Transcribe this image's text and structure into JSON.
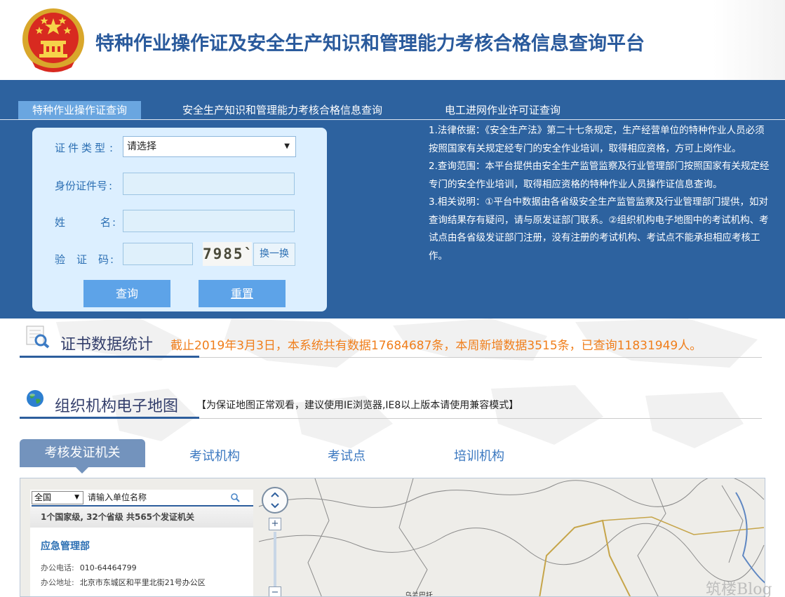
{
  "header": {
    "title": "特种作业操作证及安全生产知识和管理能力考核合格信息查询平台"
  },
  "tabs": [
    {
      "label": "特种作业操作证查询",
      "active": true
    },
    {
      "label": "安全生产知识和管理能力考核合格信息查询",
      "active": false
    },
    {
      "label": "电工进网作业许可证查询",
      "active": false
    }
  ],
  "query_form": {
    "cert_type_label": "证件类型",
    "cert_type_value": "请选择",
    "id_label": "身份证件号",
    "name_label_1": "姓",
    "name_label_2": "名",
    "code_label_1": "验",
    "code_label_2": "证",
    "code_label_3": "码",
    "colon": ":",
    "captcha_text": "7985`",
    "refresh_label": "换一换",
    "query_label": "查询",
    "reset_label": "重置"
  },
  "notes": [
    "1.法律依据：《安全生产法》第二十七条规定，生产经营单位的特种作业人员必须按照国家有关规定经专门的安全作业培训，取得相应资格，方可上岗作业。",
    "2.查询范围：本平台提供由安全生产监管监察及行业管理部门按照国家有关规定经专门的安全作业培训，取得相应资格的特种作业人员操作证信息查询。",
    "3.相关说明：①平台中数据由各省级安全生产监管监察及行业管理部门提供，如对查询结果存有疑问，请与原发证部门联系。②组织机构电子地图中的考试机构、考试点由各省级发证部门注册，没有注册的考试机构、考试点不能承担相应考核工作。"
  ],
  "stats": {
    "title": "证书数据统计",
    "text": "截止2019年3月3日，本系统共有数据17684687条，本周新增数据3515条，已查询11831949人。"
  },
  "map_section": {
    "title": "组织机构电子地图",
    "note": "【为保证地图正常观看，建议使用IE浏览器,IE8以上版本请使用兼容模式】"
  },
  "org_tabs": [
    {
      "label": "考核发证机关",
      "active": true
    },
    {
      "label": "考试机构",
      "active": false
    },
    {
      "label": "考试点",
      "active": false
    },
    {
      "label": "培训机构",
      "active": false
    }
  ],
  "map_widget": {
    "region_value": "全国",
    "search_placeholder": "请输入单位名称",
    "summary": "1个国家级, 32个省级    共565个发证机关",
    "org_name": "应急管理部",
    "phone_label": "办公电话:",
    "phone_value": "010-64464799",
    "addr_label": "办公地址:",
    "addr_value": "北京市东城区和平里北街21号办公区",
    "zoom_in": "+",
    "zoom_out": "−",
    "map_place_label": "乌兰巴托"
  },
  "watermark": "筑楼Blog",
  "colors": {
    "band_blue": "#2d629f",
    "active_tab": "#6aa6e0",
    "button_blue": "#5da3e8",
    "stats_orange": "#f07e1b",
    "org_tab_active": "#7393bd"
  }
}
